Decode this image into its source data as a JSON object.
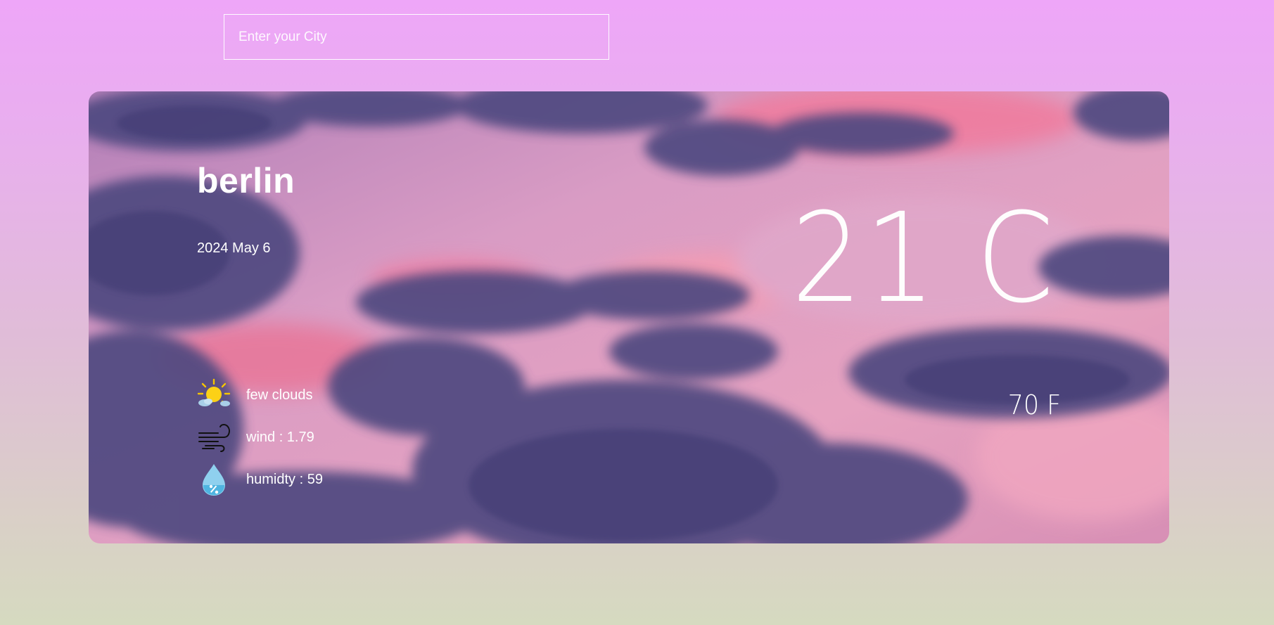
{
  "search": {
    "placeholder": "Enter your City",
    "value": ""
  },
  "weather": {
    "city": "berlin",
    "date": "2024 May 6",
    "temp_c": "21 C",
    "temp_f": "70 F",
    "details": [
      {
        "icon": "sun-behind-cloud-icon",
        "label": "few clouds"
      },
      {
        "icon": "wind-icon",
        "label": "wind : 1.79"
      },
      {
        "icon": "humidity-drop-icon",
        "label": "humidty : 59"
      }
    ]
  },
  "colors": {
    "page_top": "#eea6f8",
    "page_bottom": "#d6dac0",
    "text": "#ffffff",
    "sky_pink": "#e8a3c6",
    "cloud_purple": "#4f4a80"
  }
}
